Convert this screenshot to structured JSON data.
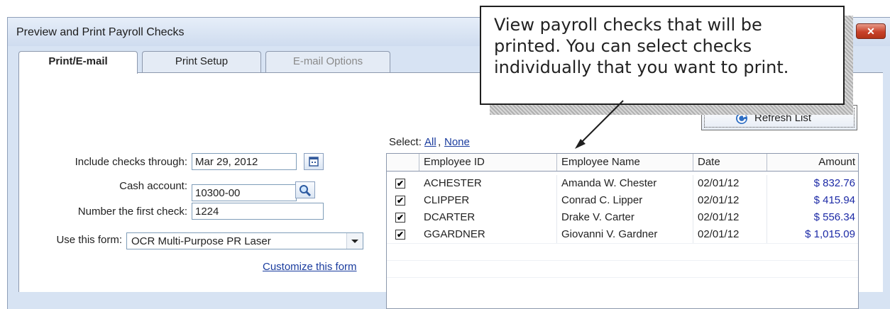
{
  "window": {
    "title": "Preview and Print Payroll Checks",
    "close_glyph": "✕"
  },
  "tabs": [
    {
      "label": "Print/E-mail",
      "active": true
    },
    {
      "label": "Print Setup",
      "active": false
    },
    {
      "label": "E-mail Options",
      "active": false
    }
  ],
  "form": {
    "checks_through_label": "Include checks through:",
    "checks_through_value": "Mar 29, 2012",
    "cash_account_label": "Cash account:",
    "cash_account_value": "10300-00",
    "first_check_label": "Number the first check:",
    "first_check_value": "1224",
    "form_label": "Use this form:",
    "form_value": "OCR Multi-Purpose PR Laser",
    "customize_link": "Customize this form"
  },
  "select": {
    "label": "Select:",
    "all": "All",
    "separator": ",",
    "none": "None"
  },
  "refresh_button": "Refresh List",
  "grid": {
    "columns": [
      "Employee ID",
      "Employee Name",
      "Date",
      "Amount"
    ],
    "rows": [
      {
        "checked": "✔",
        "id": "ACHESTER",
        "name": "Amanda W. Chester",
        "date": "02/01/12",
        "amount": "$ 832.76"
      },
      {
        "checked": "✔",
        "id": "CLIPPER",
        "name": "Conrad C. Lipper",
        "date": "02/01/12",
        "amount": "$ 415.94"
      },
      {
        "checked": "✔",
        "id": "DCARTER",
        "name": "Drake V. Carter",
        "date": "02/01/12",
        "amount": "$ 556.34"
      },
      {
        "checked": "✔",
        "id": "GGARDNER",
        "name": "Giovanni V. Gardner",
        "date": "02/01/12",
        "amount": "$ 1,015.09"
      }
    ]
  },
  "callout": {
    "text": "View payroll checks that will be printed. You can select checks individually that you want to print."
  },
  "icons": {
    "calendar": "calendar-icon",
    "lookup": "magnifier-icon",
    "dropdown": "chevron-down-icon",
    "refresh": "refresh-icon"
  },
  "colors": {
    "link": "#1a3c9e",
    "amount": "#1c2aa6",
    "window_bg": "#d7e3f3",
    "close": "#c8422a"
  }
}
